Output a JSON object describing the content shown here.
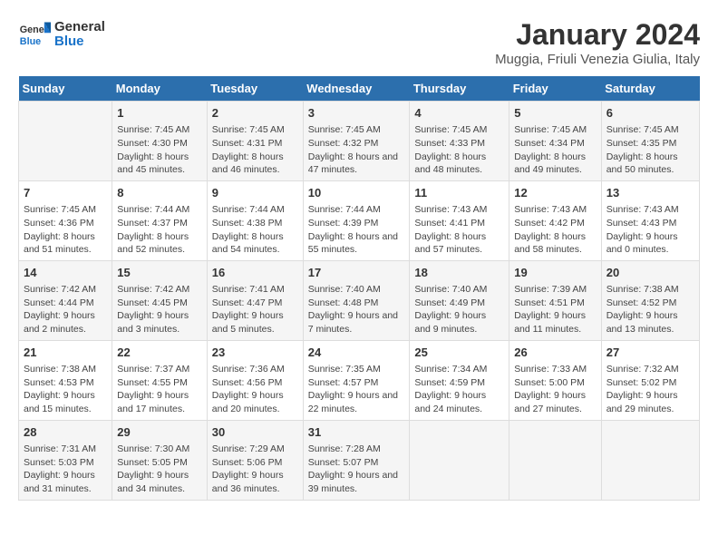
{
  "logo": {
    "line1": "General",
    "line2": "Blue"
  },
  "title": "January 2024",
  "location": "Muggia, Friuli Venezia Giulia, Italy",
  "days_of_week": [
    "Sunday",
    "Monday",
    "Tuesday",
    "Wednesday",
    "Thursday",
    "Friday",
    "Saturday"
  ],
  "weeks": [
    [
      {
        "day": "",
        "content": ""
      },
      {
        "day": "1",
        "content": "Sunrise: 7:45 AM\nSunset: 4:30 PM\nDaylight: 8 hours and 45 minutes."
      },
      {
        "day": "2",
        "content": "Sunrise: 7:45 AM\nSunset: 4:31 PM\nDaylight: 8 hours and 46 minutes."
      },
      {
        "day": "3",
        "content": "Sunrise: 7:45 AM\nSunset: 4:32 PM\nDaylight: 8 hours and 47 minutes."
      },
      {
        "day": "4",
        "content": "Sunrise: 7:45 AM\nSunset: 4:33 PM\nDaylight: 8 hours and 48 minutes."
      },
      {
        "day": "5",
        "content": "Sunrise: 7:45 AM\nSunset: 4:34 PM\nDaylight: 8 hours and 49 minutes."
      },
      {
        "day": "6",
        "content": "Sunrise: 7:45 AM\nSunset: 4:35 PM\nDaylight: 8 hours and 50 minutes."
      }
    ],
    [
      {
        "day": "7",
        "content": "Sunrise: 7:45 AM\nSunset: 4:36 PM\nDaylight: 8 hours and 51 minutes."
      },
      {
        "day": "8",
        "content": "Sunrise: 7:44 AM\nSunset: 4:37 PM\nDaylight: 8 hours and 52 minutes."
      },
      {
        "day": "9",
        "content": "Sunrise: 7:44 AM\nSunset: 4:38 PM\nDaylight: 8 hours and 54 minutes."
      },
      {
        "day": "10",
        "content": "Sunrise: 7:44 AM\nSunset: 4:39 PM\nDaylight: 8 hours and 55 minutes."
      },
      {
        "day": "11",
        "content": "Sunrise: 7:43 AM\nSunset: 4:41 PM\nDaylight: 8 hours and 57 minutes."
      },
      {
        "day": "12",
        "content": "Sunrise: 7:43 AM\nSunset: 4:42 PM\nDaylight: 8 hours and 58 minutes."
      },
      {
        "day": "13",
        "content": "Sunrise: 7:43 AM\nSunset: 4:43 PM\nDaylight: 9 hours and 0 minutes."
      }
    ],
    [
      {
        "day": "14",
        "content": "Sunrise: 7:42 AM\nSunset: 4:44 PM\nDaylight: 9 hours and 2 minutes."
      },
      {
        "day": "15",
        "content": "Sunrise: 7:42 AM\nSunset: 4:45 PM\nDaylight: 9 hours and 3 minutes."
      },
      {
        "day": "16",
        "content": "Sunrise: 7:41 AM\nSunset: 4:47 PM\nDaylight: 9 hours and 5 minutes."
      },
      {
        "day": "17",
        "content": "Sunrise: 7:40 AM\nSunset: 4:48 PM\nDaylight: 9 hours and 7 minutes."
      },
      {
        "day": "18",
        "content": "Sunrise: 7:40 AM\nSunset: 4:49 PM\nDaylight: 9 hours and 9 minutes."
      },
      {
        "day": "19",
        "content": "Sunrise: 7:39 AM\nSunset: 4:51 PM\nDaylight: 9 hours and 11 minutes."
      },
      {
        "day": "20",
        "content": "Sunrise: 7:38 AM\nSunset: 4:52 PM\nDaylight: 9 hours and 13 minutes."
      }
    ],
    [
      {
        "day": "21",
        "content": "Sunrise: 7:38 AM\nSunset: 4:53 PM\nDaylight: 9 hours and 15 minutes."
      },
      {
        "day": "22",
        "content": "Sunrise: 7:37 AM\nSunset: 4:55 PM\nDaylight: 9 hours and 17 minutes."
      },
      {
        "day": "23",
        "content": "Sunrise: 7:36 AM\nSunset: 4:56 PM\nDaylight: 9 hours and 20 minutes."
      },
      {
        "day": "24",
        "content": "Sunrise: 7:35 AM\nSunset: 4:57 PM\nDaylight: 9 hours and 22 minutes."
      },
      {
        "day": "25",
        "content": "Sunrise: 7:34 AM\nSunset: 4:59 PM\nDaylight: 9 hours and 24 minutes."
      },
      {
        "day": "26",
        "content": "Sunrise: 7:33 AM\nSunset: 5:00 PM\nDaylight: 9 hours and 27 minutes."
      },
      {
        "day": "27",
        "content": "Sunrise: 7:32 AM\nSunset: 5:02 PM\nDaylight: 9 hours and 29 minutes."
      }
    ],
    [
      {
        "day": "28",
        "content": "Sunrise: 7:31 AM\nSunset: 5:03 PM\nDaylight: 9 hours and 31 minutes."
      },
      {
        "day": "29",
        "content": "Sunrise: 7:30 AM\nSunset: 5:05 PM\nDaylight: 9 hours and 34 minutes."
      },
      {
        "day": "30",
        "content": "Sunrise: 7:29 AM\nSunset: 5:06 PM\nDaylight: 9 hours and 36 minutes."
      },
      {
        "day": "31",
        "content": "Sunrise: 7:28 AM\nSunset: 5:07 PM\nDaylight: 9 hours and 39 minutes."
      },
      {
        "day": "",
        "content": ""
      },
      {
        "day": "",
        "content": ""
      },
      {
        "day": "",
        "content": ""
      }
    ]
  ]
}
